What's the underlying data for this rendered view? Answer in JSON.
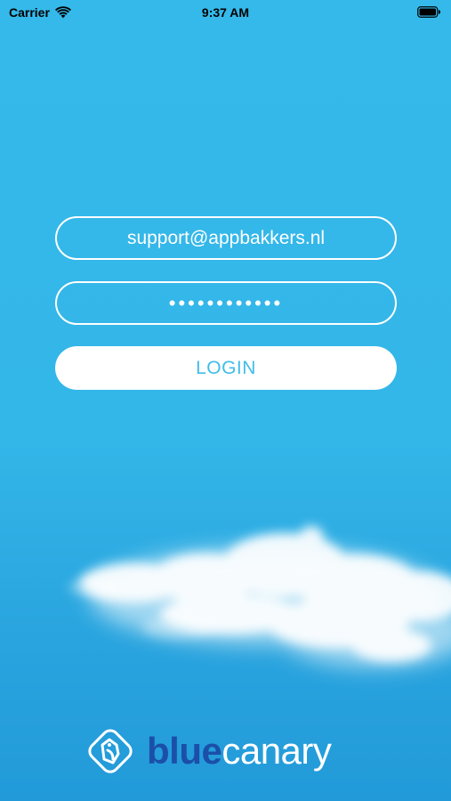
{
  "status_bar": {
    "carrier": "Carrier",
    "time": "9:37 AM"
  },
  "login": {
    "email_value": "support@appbakkers.nl",
    "password_value": "••••••••••••",
    "login_label": "LOGIN"
  },
  "brand": {
    "name_part1": "blue",
    "name_part2": "canary"
  },
  "colors": {
    "background": "#35b9ea",
    "button_text": "#42bde9",
    "brand_blue": "#1b4fa8",
    "white": "#ffffff"
  },
  "icons": {
    "wifi": "wifi-icon",
    "battery": "battery-icon",
    "logo": "canary-bird-icon"
  }
}
